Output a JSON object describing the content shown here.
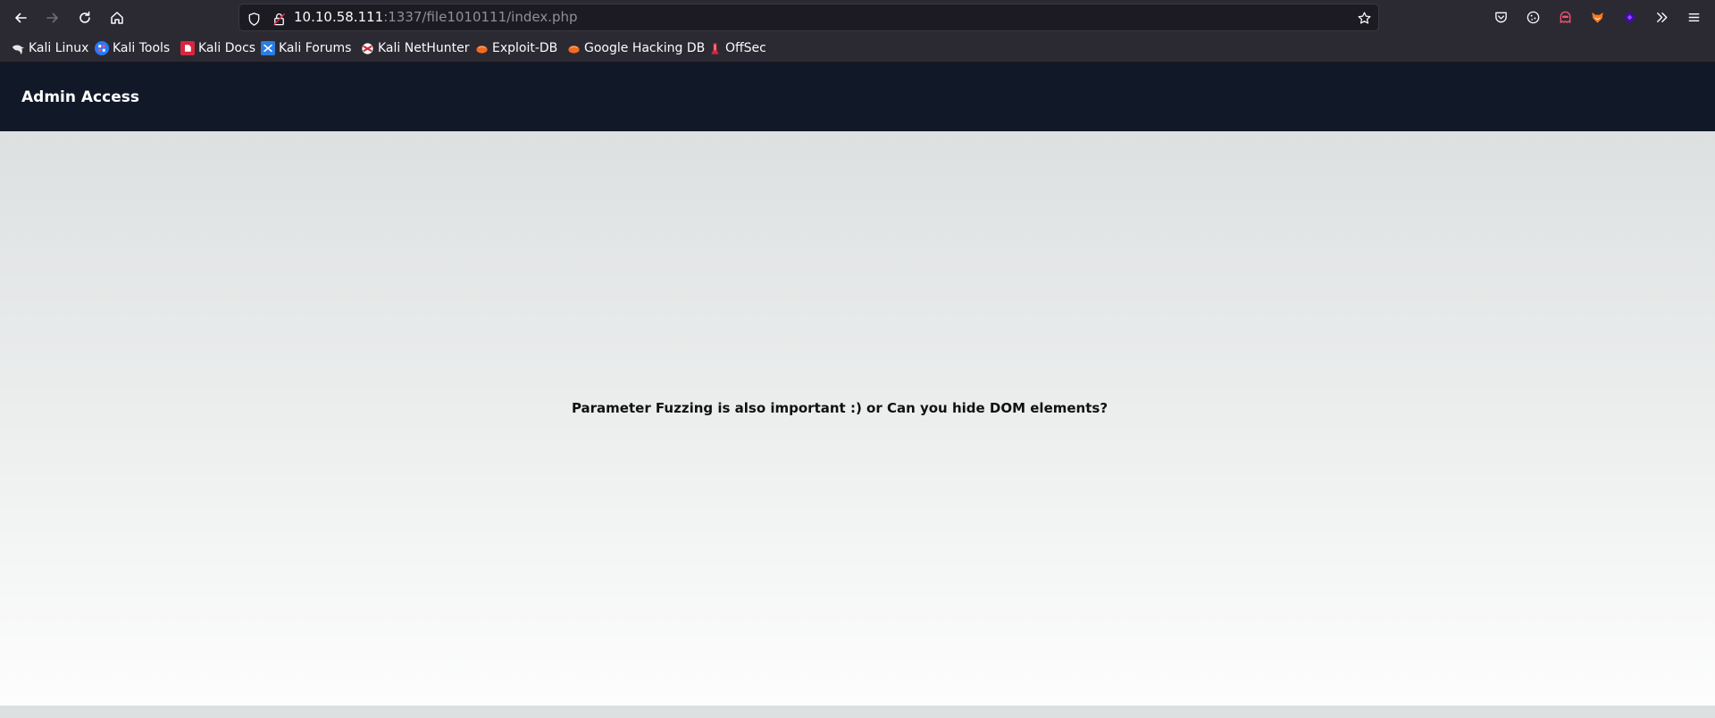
{
  "browser": {
    "url_host": "10.10.58.111",
    "url_rest": ":1337/file1010111/index.php"
  },
  "bookmarks": [
    {
      "label": "Kali Linux",
      "icon": "kali-dragon-icon"
    },
    {
      "label": "Kali Tools",
      "icon": "kali-tools-icon"
    },
    {
      "label": "Kali Docs",
      "icon": "kali-docs-icon"
    },
    {
      "label": "Kali Forums",
      "icon": "kali-forums-icon"
    },
    {
      "label": "Kali NetHunter",
      "icon": "kali-nethunter-icon"
    },
    {
      "label": "Exploit-DB",
      "icon": "exploit-db-icon"
    },
    {
      "label": "Google Hacking DB",
      "icon": "google-hacking-db-icon"
    },
    {
      "label": "OffSec",
      "icon": "offsec-icon"
    }
  ],
  "page": {
    "brand": "Admin Access",
    "message": "Parameter Fuzzing is also important :) or Can you hide DOM elements?"
  },
  "colors": {
    "toolbar_bg": "#2b2a33",
    "navbar_bg": "#111827",
    "text_dark": "#111111"
  }
}
